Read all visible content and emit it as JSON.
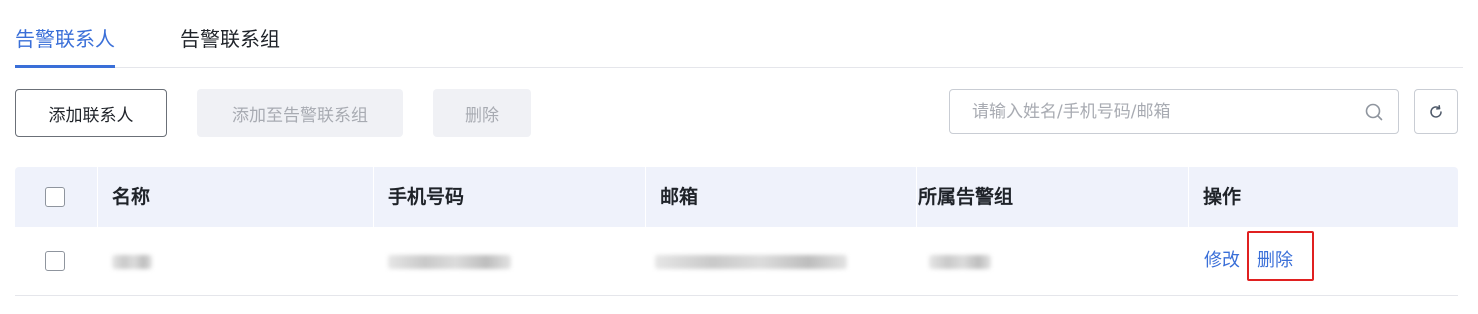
{
  "tabs": [
    {
      "label": "告警联系人",
      "active": true
    },
    {
      "label": "告警联系组",
      "active": false
    }
  ],
  "toolbar": {
    "add_label": "添加联系人",
    "add_to_group_label": "添加至告警联系组",
    "delete_label": "删除"
  },
  "search": {
    "placeholder": "请输入姓名/手机号码/邮箱",
    "value": ""
  },
  "table": {
    "columns": [
      "名称",
      "手机号码",
      "邮箱",
      "所属告警组",
      "操作"
    ],
    "rows": [
      {
        "name": "",
        "phone": "",
        "email": "",
        "group": "",
        "actions": {
          "edit": "修改",
          "delete": "删除"
        }
      }
    ]
  },
  "colors": {
    "accent": "#3a6fd8",
    "header_bg": "#eff2fb",
    "highlight_border": "#e02020"
  }
}
